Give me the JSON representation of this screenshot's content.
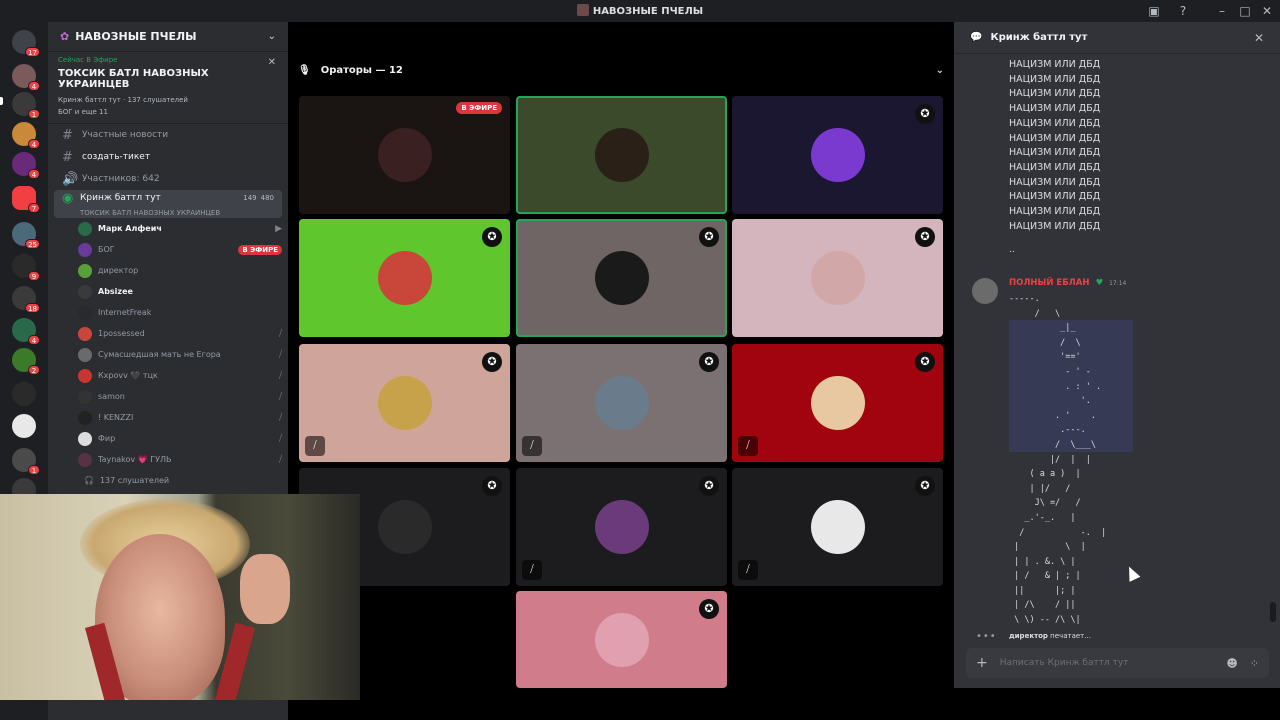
{
  "window": {
    "title": "НАВОЗНЫЕ ПЧЕЛЫ"
  },
  "server": {
    "name": "НАВОЗНЫЕ ПЧЕЛЫ",
    "live": {
      "label": "Сейчас В Эфире",
      "title": "ТОКСИК БАТЛ НАВОЗНЫХ УКРАИНЦЕВ",
      "meta": "Кринж баттл тут · 137 слушателей",
      "users": "БОГ и еще 11"
    },
    "channels": [
      {
        "label": "Участные новости",
        "type": "text"
      },
      {
        "label": "создать-тикет",
        "type": "text"
      },
      {
        "label": "Участников: 642",
        "type": "voice"
      }
    ],
    "voice": {
      "name": "Кринж баттл тут",
      "subtitle": "ТОКСИК БАТЛ НАВОЗНЫХ УКРАИНЦЕВ",
      "count_a": "149",
      "count_b": "480"
    },
    "members": [
      {
        "name": "Марк Алфеич",
        "bold": true
      },
      {
        "name": "БОГ",
        "badge": "В ЭФИРЕ"
      },
      {
        "name": "директор"
      },
      {
        "name": "Absizee",
        "bold": true
      },
      {
        "name": "InternetFreak"
      },
      {
        "name": "1possessed",
        "muted": true
      },
      {
        "name": "Сумасшедшая мать не Егора",
        "muted": true
      },
      {
        "name": "Кxpovv 🖤 тцк",
        "muted": true
      },
      {
        "name": "samon",
        "muted": true
      },
      {
        "name": "! KENZZI",
        "muted": true
      },
      {
        "name": "Фир",
        "muted": true
      },
      {
        "name": "Taynakov 💗 ГУЛЬ",
        "muted": true
      }
    ],
    "listeners": "137 слушателей"
  },
  "stage": {
    "header": "Ораторы — 12",
    "live_badge": "В ЭФИРЕ",
    "tiles": [
      {
        "bg": "#1a1413",
        "avatar": "#3a2020"
      },
      {
        "bg": "#3a4a2a",
        "avatar": "#2a2018"
      },
      {
        "bg": "#1c1730",
        "avatar": "#7a3ad0"
      },
      {
        "bg": "#5fc72d",
        "avatar": "#c9473a"
      },
      {
        "bg": "#6f6564",
        "avatar": "#1a1a1a"
      },
      {
        "bg": "#d5b5bd",
        "avatar": "#d1a7a7"
      },
      {
        "bg": "#cfa49a",
        "avatar": "#c7a24a"
      },
      {
        "bg": "#7b7172",
        "avatar": "#6a7c8c"
      },
      {
        "bg": "#a2040f",
        "avatar": "#e8c8a0"
      },
      {
        "bg": "#1c1c1e",
        "avatar": "#2a2a2a"
      },
      {
        "bg": "#1c1c1e",
        "avatar": "#6a3a7a"
      },
      {
        "bg": "#1c1c1e",
        "avatar": "#e8e8e8"
      },
      {
        "bg": "#d07c8b",
        "avatar": "#e0a0b0"
      }
    ]
  },
  "chat": {
    "title": "Кринж баттл тут",
    "repeated_line": "НАЦИЗМ ИЛИ ДБД",
    "dots": "..",
    "author": "ПОЛНЫЙ ЕБЛАН",
    "time": "17:14",
    "typing_user": "директор",
    "typing_suffix": " печатает...",
    "placeholder": "Написать Кринж баттл тут"
  },
  "colors": {
    "accent": "#5865f2",
    "live": "#da373c",
    "speaking": "#23a55a"
  }
}
